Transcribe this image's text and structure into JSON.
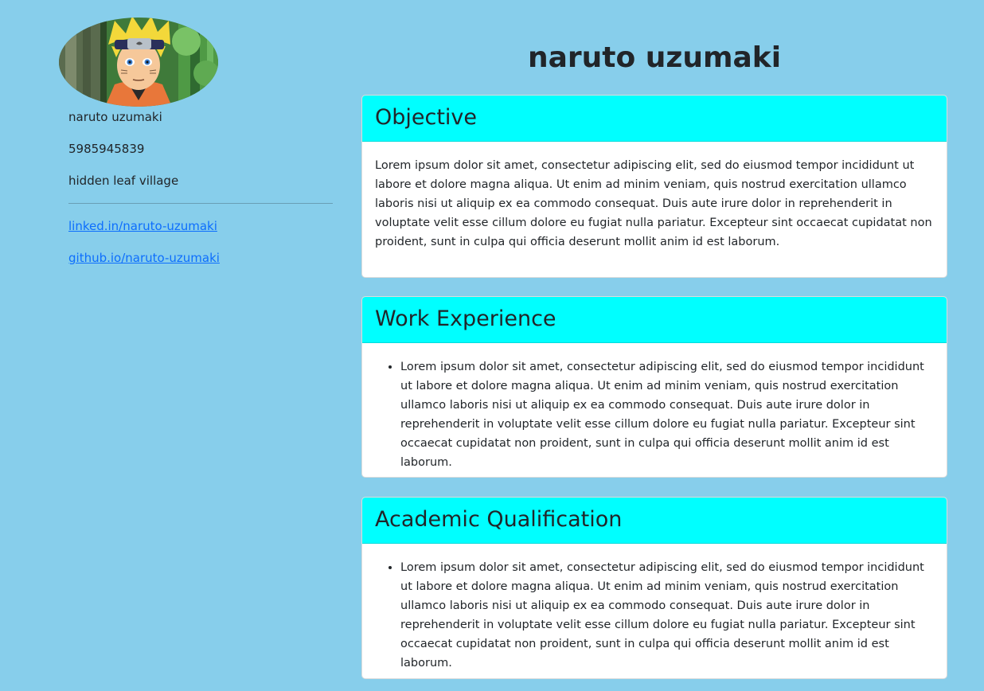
{
  "sidebar": {
    "avatar_alt": "naruto uzumaki avatar",
    "name": "naruto uzumaki",
    "phone": "5985945839",
    "address": "hidden leaf village",
    "links": [
      {
        "label": "linked.in/naruto-uzumaki"
      },
      {
        "label": "github.io/naruto-uzumaki"
      }
    ]
  },
  "main": {
    "title": "naruto uzumaki",
    "sections": [
      {
        "heading": "Objective",
        "text": "Lorem ipsum dolor sit amet, consectetur adipiscing elit, sed do eiusmod tempor incididunt ut labore et dolore magna aliqua. Ut enim ad minim veniam, quis nostrud exercitation ullamco laboris nisi ut aliquip ex ea commodo consequat. Duis aute irure dolor in reprehenderit in voluptate velit esse cillum dolore eu fugiat nulla pariatur. Excepteur sint occaecat cupidatat non proident, sunt in culpa qui officia deserunt mollit anim id est laborum."
      },
      {
        "heading": "Work Experience",
        "items": [
          "Lorem ipsum dolor sit amet, consectetur adipiscing elit, sed do eiusmod tempor incididunt ut labore et dolore magna aliqua. Ut enim ad minim veniam, quis nostrud exercitation ullamco laboris nisi ut aliquip ex ea commodo consequat. Duis aute irure dolor in reprehenderit in voluptate velit esse cillum dolore eu fugiat nulla pariatur. Excepteur sint occaecat cupidatat non proident, sunt in culpa qui officia deserunt mollit anim id est laborum."
        ]
      },
      {
        "heading": "Academic Qualification",
        "items": [
          "Lorem ipsum dolor sit amet, consectetur adipiscing elit, sed do eiusmod tempor incididunt ut labore et dolore magna aliqua. Ut enim ad minim veniam, quis nostrud exercitation ullamco laboris nisi ut aliquip ex ea commodo consequat. Duis aute irure dolor in reprehenderit in voluptate velit esse cillum dolore eu fugiat nulla pariatur. Excepteur sint occaecat cupidatat non proident, sunt in culpa qui officia deserunt mollit anim id est laborum."
        ]
      }
    ]
  },
  "colors": {
    "page_background": "#87ceeb",
    "card_header": "#00ffff",
    "link": "#0d6efd",
    "text": "#212529"
  }
}
